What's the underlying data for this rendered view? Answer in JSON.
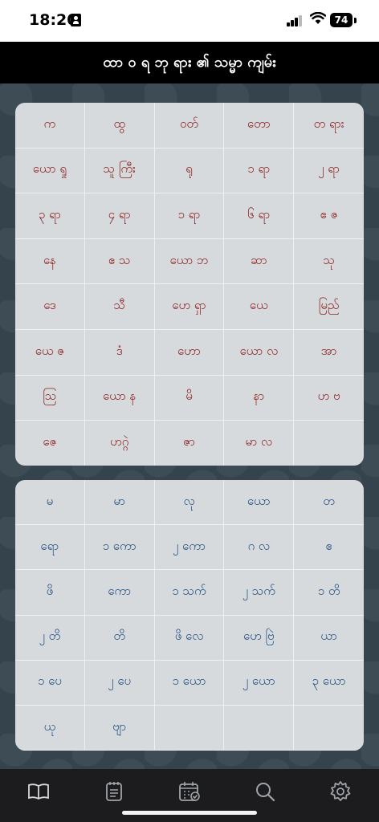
{
  "status": {
    "time": "18:20",
    "battery": "74"
  },
  "header": {
    "title": "ထာ ဝ ရ ဘု ရား ၏ သမ္မာ ကျမ်း"
  },
  "books_top": [
    "က",
    "ထွ",
    "ဝတ်",
    "တော",
    "တ ရား",
    "ယော ရှု",
    "သူ ကြီး",
    "ရု",
    "၁ ရာ",
    "၂ ရာ",
    "၃ ရာ",
    "၄ ရာ",
    "၁ ရာ",
    "၆ ရာ",
    "ဧ ဇ",
    "နေ",
    "ဧ သ",
    "ယော ဘ",
    "ဆာ",
    "သု",
    "ဒေ",
    "သီ",
    "ဟေ ရှာ",
    "ယေ",
    "မြည်",
    "ယေ ဇ",
    "ဒံ",
    "ဟော",
    "ယော လ",
    "အာ",
    "သြ",
    "ယော န",
    "မိ",
    "နာ",
    "ဟ ဗ",
    "ဇေ",
    "ဟဂ္ဂဲ",
    "ဇာ",
    "မာ လ",
    ""
  ],
  "books_bottom": [
    "မ",
    "မာ",
    "လု",
    "ယော",
    "တ",
    "ရော",
    "၁ ကော",
    "၂ ကော",
    "ဂ လ",
    "ဧ",
    "ဖိ",
    "ကော",
    "၁ သက်",
    "၂ သက်",
    "၁ တိ",
    "၂ တိ",
    "တိ",
    "ဖိ လေ",
    "ဟေ ဗြဲ",
    "ယာ",
    "၁ ပေ",
    "၂ ပေ",
    "၁ ယော",
    "၂ ယော",
    "၃ ယော",
    "ယု",
    "ဗျာ",
    "",
    "",
    ""
  ],
  "tabs": [
    "bible-book-icon",
    "notes-icon",
    "calendar-icon",
    "search-icon",
    "settings-gear-icon"
  ],
  "colors": {
    "old_testament": "#8b1a1a",
    "new_testament": "#1e4c80",
    "tab_icon": "#a0a4a8"
  }
}
